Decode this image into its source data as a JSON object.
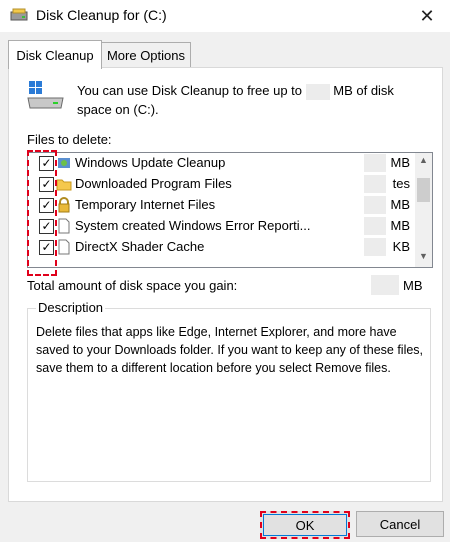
{
  "window": {
    "title": "Disk Cleanup for  (C:)",
    "close_symbol": "✕"
  },
  "tabs": [
    {
      "label": "Disk Cleanup",
      "active": true
    },
    {
      "label": "More Options",
      "active": false
    }
  ],
  "intro": {
    "text_before": "You can use Disk Cleanup to free up to",
    "text_after": "MB of disk space on  (C:)."
  },
  "files_label": "Files to delete:",
  "files": [
    {
      "name": "Windows Update Cleanup",
      "size": "MB",
      "checked": true,
      "icon": "windows-update-icon"
    },
    {
      "name": "Downloaded Program Files",
      "size": "tes",
      "checked": true,
      "icon": "folder-icon"
    },
    {
      "name": "Temporary Internet Files",
      "size": "MB",
      "checked": true,
      "icon": "lock-icon"
    },
    {
      "name": "System created Windows Error Reporti...",
      "size": "MB",
      "checked": true,
      "icon": "file-icon"
    },
    {
      "name": "DirectX Shader Cache",
      "size": "KB",
      "checked": true,
      "icon": "file-icon"
    }
  ],
  "total": {
    "label": "Total amount of disk space you gain:",
    "unit": "MB"
  },
  "description": {
    "title": "Description",
    "text": "Delete files that apps like Edge, Internet Explorer, and more have saved to your Downloads folder. If you want to keep any of these files, save them to a different location before you select Remove files."
  },
  "buttons": {
    "ok": "OK",
    "cancel": "Cancel"
  },
  "colors": {
    "highlight": "#e0001b",
    "focus": "#0078d7"
  }
}
